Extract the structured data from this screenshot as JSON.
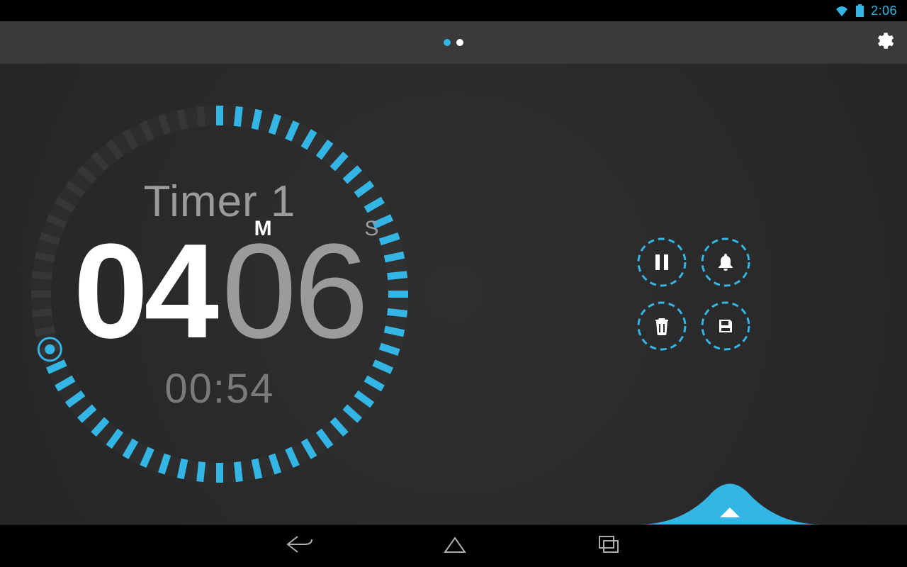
{
  "status": {
    "time": "2:06",
    "wifi_icon": "wifi-icon",
    "battery_icon": "battery-icon"
  },
  "header": {
    "page_indicator": {
      "total": 2,
      "active_index": 0
    },
    "settings_icon": "gear-icon"
  },
  "colors": {
    "accent": "#33b5e5",
    "muted": "#8a8a8a",
    "bg": "#2c2c2c"
  },
  "timer": {
    "name": "Timer 1",
    "minutes": "04",
    "seconds": "06",
    "unit_m": "M",
    "unit_s": "S",
    "elapsed": "00:54",
    "progress_total_segments": 60,
    "progress_filled_segments": 42
  },
  "actions": {
    "pause_icon": "pause-icon",
    "bell_icon": "bell-icon",
    "trash_icon": "trash-icon",
    "save_icon": "save-icon"
  },
  "nav": {
    "back_icon": "back-icon",
    "home_icon": "home-icon",
    "recent_icon": "recent-icon"
  }
}
